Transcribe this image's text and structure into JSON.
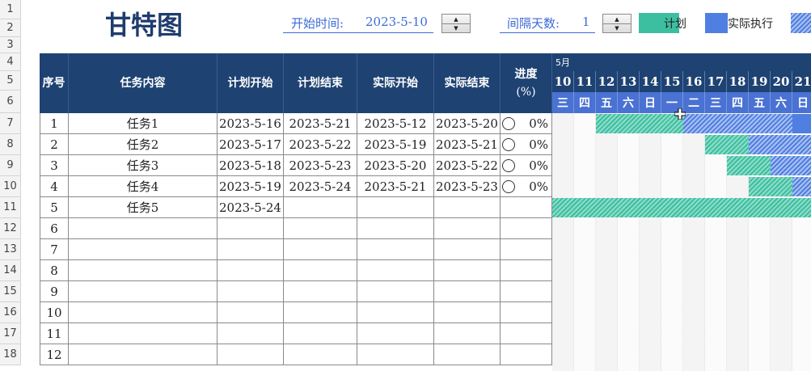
{
  "title": "甘特图",
  "controls": {
    "start_label": "开始时间:",
    "start_value": "2023-5-10",
    "interval_label": "间隔天数:",
    "interval_value": "1"
  },
  "legend": {
    "plan_label": "计划",
    "actual_label": "实际执行",
    "colors": {
      "plan": "#3cbfa1",
      "actual": "#4f7fe0",
      "header": "#1e4272",
      "weekday": "#4a72d3"
    }
  },
  "row_numbers": [
    "1",
    "2",
    "3",
    "4",
    "5",
    "6",
    "7",
    "8",
    "9",
    "10",
    "11",
    "12",
    "13",
    "14",
    "15",
    "16",
    "17",
    "18"
  ],
  "table": {
    "headers": {
      "seq": "序号",
      "task": "任务内容",
      "plan_start": "计划开始",
      "plan_end": "计划结束",
      "actual_start": "实际开始",
      "actual_end": "实际结束",
      "progress_line1": "进度",
      "progress_line2": "(%)"
    },
    "rows": [
      {
        "seq": "1",
        "task": "任务1",
        "plan_start": "2023-5-16",
        "plan_end": "2023-5-21",
        "actual_start": "2023-5-12",
        "actual_end": "2023-5-20",
        "progress": "0%"
      },
      {
        "seq": "2",
        "task": "任务2",
        "plan_start": "2023-5-17",
        "plan_end": "2023-5-22",
        "actual_start": "2023-5-19",
        "actual_end": "2023-5-21",
        "progress": "0%"
      },
      {
        "seq": "3",
        "task": "任务3",
        "plan_start": "2023-5-18",
        "plan_end": "2023-5-23",
        "actual_start": "2023-5-20",
        "actual_end": "2023-5-22",
        "progress": "0%"
      },
      {
        "seq": "4",
        "task": "任务4",
        "plan_start": "2023-5-19",
        "plan_end": "2023-5-24",
        "actual_start": "2023-5-21",
        "actual_end": "2023-5-23",
        "progress": "0%"
      },
      {
        "seq": "5",
        "task": "任务5",
        "plan_start": "2023-5-24",
        "plan_end": "",
        "actual_start": "",
        "actual_end": "",
        "progress": ""
      },
      {
        "seq": "6",
        "task": "",
        "plan_start": "",
        "plan_end": "",
        "actual_start": "",
        "actual_end": "",
        "progress": ""
      },
      {
        "seq": "7",
        "task": "",
        "plan_start": "",
        "plan_end": "",
        "actual_start": "",
        "actual_end": "",
        "progress": ""
      },
      {
        "seq": "8",
        "task": "",
        "plan_start": "",
        "plan_end": "",
        "actual_start": "",
        "actual_end": "",
        "progress": ""
      },
      {
        "seq": "9",
        "task": "",
        "plan_start": "",
        "plan_end": "",
        "actual_start": "",
        "actual_end": "",
        "progress": ""
      },
      {
        "seq": "10",
        "task": "",
        "plan_start": "",
        "plan_end": "",
        "actual_start": "",
        "actual_end": "",
        "progress": ""
      },
      {
        "seq": "11",
        "task": "",
        "plan_start": "",
        "plan_end": "",
        "actual_start": "",
        "actual_end": "",
        "progress": ""
      },
      {
        "seq": "12",
        "task": "",
        "plan_start": "",
        "plan_end": "",
        "actual_start": "",
        "actual_end": "",
        "progress": ""
      }
    ]
  },
  "gantt": {
    "month": "5月",
    "days": [
      "10",
      "11",
      "12",
      "13",
      "14",
      "15",
      "16",
      "17",
      "18",
      "19",
      "20",
      "21"
    ],
    "weekdays": [
      "三",
      "四",
      "五",
      "六",
      "日",
      "一",
      "二",
      "三",
      "四",
      "五",
      "六",
      "日"
    ]
  }
}
